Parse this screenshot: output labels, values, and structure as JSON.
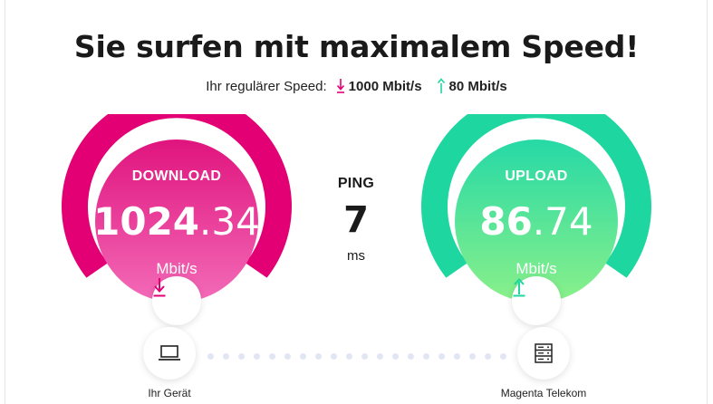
{
  "headline": "Sie surfen mit maximalem Speed!",
  "regular_speed": {
    "label": "Ihr regulärer Speed:",
    "download": "1000 Mbit/s",
    "upload": "80 Mbit/s"
  },
  "download": {
    "label": "DOWNLOAD",
    "value_int": "1024",
    "value_dec": ".34",
    "unit": "Mbit/s",
    "icon": "arrow-down-icon",
    "color": "#e20074"
  },
  "ping": {
    "label": "PING",
    "value": "7",
    "unit": "ms"
  },
  "upload": {
    "label": "UPLOAD",
    "value_int": "86",
    "value_dec": ".74",
    "unit": "Mbit/s",
    "icon": "arrow-up-icon",
    "color": "#1ed6a0"
  },
  "devices": {
    "left_label": "Ihr Gerät",
    "left_icon": "laptop-icon",
    "right_label": "Magenta Telekom",
    "right_icon": "server-icon"
  }
}
